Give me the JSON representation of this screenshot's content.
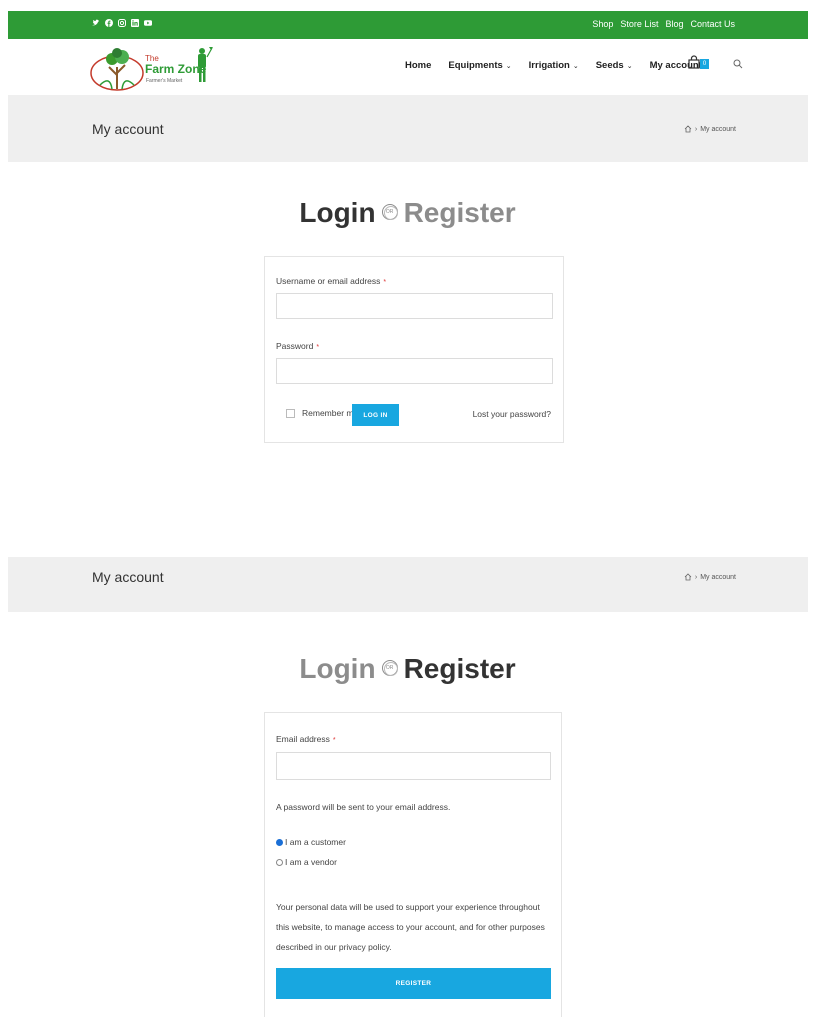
{
  "topbar": {
    "social": [
      "twitter-icon",
      "facebook-icon",
      "instagram-icon",
      "linkedin-icon",
      "youtube-icon"
    ],
    "links": [
      "Shop",
      "Store List",
      "Blog",
      "Contact Us"
    ],
    "color": "#2e9b36"
  },
  "logo": {
    "the": "The",
    "name": "Farm Zone",
    "tagline": "Farmer's Market"
  },
  "nav": {
    "home": "Home",
    "equipments": "Equipments",
    "irrigation": "Irrigation",
    "seeds": "Seeds",
    "my_account": "My account",
    "cart_count": "0"
  },
  "section1": {
    "title": "My account",
    "breadcrumb": "My account",
    "heading_login": "Login",
    "heading_or": "OR",
    "heading_register": "Register",
    "username_label": "Username or email address",
    "password_label": "Password",
    "required_mark": "*",
    "remember_label": "Remember me",
    "login_button": "LOG IN",
    "lost_password": "Lost your password?"
  },
  "section2": {
    "title": "My account",
    "breadcrumb": "My account",
    "heading_login": "Login",
    "heading_or": "OR",
    "heading_register": "Register",
    "email_label": "Email address",
    "required_mark": "*",
    "password_note": "A password will be sent to your email address.",
    "customer_option": "I am a customer",
    "vendor_option": "I am a vendor",
    "privacy_text": "Your personal data will be used to support your experience throughout this website, to manage access to your account, and for other purposes described in our privacy policy.",
    "register_button": "REGISTER"
  },
  "accent_color": "#18a7e0"
}
